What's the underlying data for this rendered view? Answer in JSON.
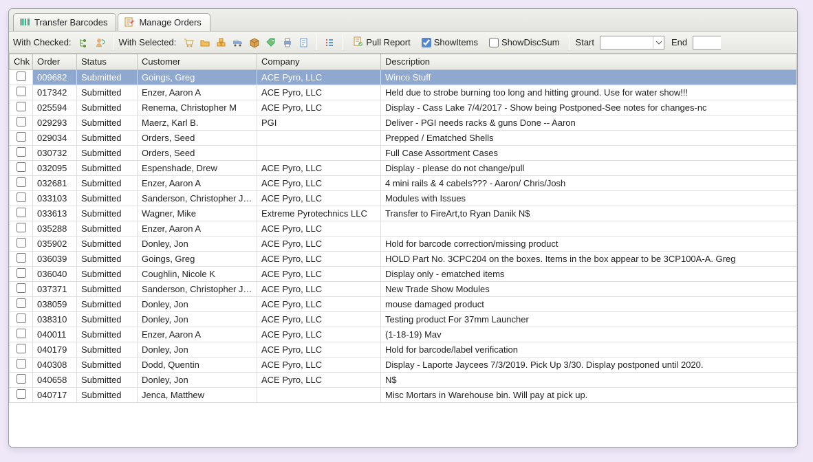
{
  "tabs": [
    {
      "label": "Transfer Barcodes",
      "icon": "barcode-icon"
    },
    {
      "label": "Manage Orders",
      "icon": "orders-icon",
      "active": true
    }
  ],
  "toolbar": {
    "withCheckedLabel": "With Checked:",
    "withSelectedLabel": "With Selected:",
    "pullReportLabel": "Pull Report",
    "showItemsLabel": "ShowItems",
    "showDiscSumLabel": "ShowDiscSum",
    "startLabel": "Start",
    "endLabel": "End",
    "showItemsChecked": true,
    "showDiscSumChecked": false
  },
  "columns": {
    "chk": "Chk",
    "order": "Order",
    "status": "Status",
    "customer": "Customer",
    "company": "Company",
    "description": "Description"
  },
  "rows": [
    {
      "order": "009682",
      "status": "Submitted",
      "customer": "Goings, Greg",
      "company": "ACE Pyro, LLC",
      "description": "Winco Stuff",
      "selected": true
    },
    {
      "order": "017342",
      "status": "Submitted",
      "customer": "Enzer, Aaron A",
      "company": "ACE Pyro, LLC",
      "description": "Held due to strobe burning too long and hitting ground.  Use for water show!!!"
    },
    {
      "order": "025594",
      "status": "Submitted",
      "customer": "Renema, Christopher M",
      "company": "ACE Pyro, LLC",
      "description": "Display - Cass Lake 7/4/2017 - Show being Postponed-See notes for changes-nc"
    },
    {
      "order": "029293",
      "status": "Submitted",
      "customer": "Maerz, Karl B.",
      "company": "PGI",
      "description": "Deliver - PGI needs racks & guns Done -- Aaron"
    },
    {
      "order": "029034",
      "status": "Submitted",
      "customer": "Orders, Seed",
      "company": "",
      "description": "Prepped / Ematched Shells"
    },
    {
      "order": "030732",
      "status": "Submitted",
      "customer": "Orders, Seed",
      "company": "",
      "description": "Full Case Assortment Cases"
    },
    {
      "order": "032095",
      "status": "Submitted",
      "customer": "Espenshade, Drew",
      "company": "ACE Pyro, LLC",
      "description": "Display - please do not change/pull"
    },
    {
      "order": "032681",
      "status": "Submitted",
      "customer": "Enzer, Aaron A",
      "company": "ACE Pyro, LLC",
      "description": "4 mini rails & 4 cabels??? - Aaron/ Chris/Josh"
    },
    {
      "order": "033103",
      "status": "Submitted",
      "customer": "Sanderson, Christopher  Ja...",
      "company": "ACE Pyro, LLC",
      "description": "Modules with Issues"
    },
    {
      "order": "033613",
      "status": "Submitted",
      "customer": "Wagner, Mike",
      "company": "Extreme Pyrotechnics LLC",
      "description": "Transfer to FireArt,to Ryan Danik N$"
    },
    {
      "order": "035288",
      "status": "Submitted",
      "customer": "Enzer, Aaron A",
      "company": "ACE Pyro, LLC",
      "description": ""
    },
    {
      "order": "035902",
      "status": "Submitted",
      "customer": "Donley, Jon",
      "company": "ACE Pyro, LLC",
      "description": "Hold for barcode correction/missing product"
    },
    {
      "order": "036039",
      "status": "Submitted",
      "customer": "Goings, Greg",
      "company": "ACE Pyro, LLC",
      "description": "HOLD Part No. 3CPC204 on the boxes.  Items in the box appear to be 3CP100A-A. Greg"
    },
    {
      "order": "036040",
      "status": "Submitted",
      "customer": "Coughlin, Nicole K",
      "company": "ACE Pyro, LLC",
      "description": "Display only - ematched items"
    },
    {
      "order": "037371",
      "status": "Submitted",
      "customer": "Sanderson, Christopher  Ja...",
      "company": "ACE Pyro, LLC",
      "description": "New Trade Show Modules"
    },
    {
      "order": "038059",
      "status": "Submitted",
      "customer": "Donley, Jon",
      "company": "ACE Pyro, LLC",
      "description": "mouse damaged product"
    },
    {
      "order": "038310",
      "status": "Submitted",
      "customer": "Donley, Jon",
      "company": "ACE Pyro, LLC",
      "description": "Testing product For 37mm Launcher"
    },
    {
      "order": "040011",
      "status": "Submitted",
      "customer": "Enzer, Aaron A",
      "company": "ACE Pyro, LLC",
      "description": "(1-18-19) Mav"
    },
    {
      "order": "040179",
      "status": "Submitted",
      "customer": "Donley, Jon",
      "company": "ACE Pyro, LLC",
      "description": "Hold for barcode/label verification"
    },
    {
      "order": "040308",
      "status": "Submitted",
      "customer": "Dodd, Quentin",
      "company": "ACE Pyro, LLC",
      "description": "Display - Laporte Jaycees 7/3/2019. Pick Up 3/30. Display postponed until 2020."
    },
    {
      "order": "040658",
      "status": "Submitted",
      "customer": "Donley, Jon",
      "company": "ACE Pyro, LLC",
      "description": "N$"
    },
    {
      "order": "040717",
      "status": "Submitted",
      "customer": "Jenca, Matthew",
      "company": "",
      "description": "Misc Mortars in Warehouse bin. Will pay at pick up."
    }
  ]
}
